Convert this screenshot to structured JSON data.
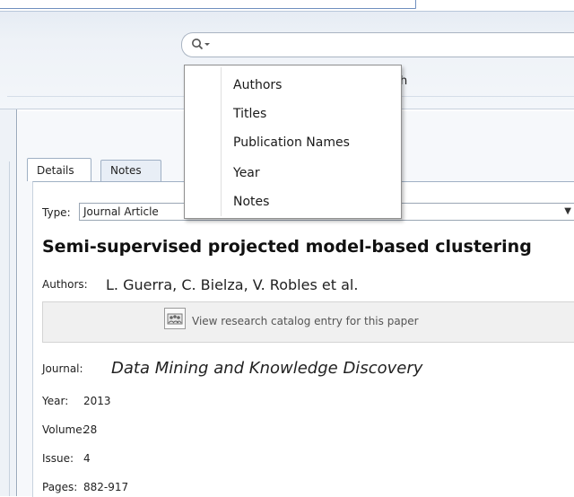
{
  "toolbar": {
    "search_placeholder": "",
    "caption_fragment": "h"
  },
  "search_menu": {
    "items": [
      "Authors",
      "Titles",
      "Publication Names",
      "Year",
      "Notes"
    ]
  },
  "tabs": [
    {
      "label": "Details",
      "active": true
    },
    {
      "label": "Notes",
      "active": false
    }
  ],
  "details": {
    "type_label": "Type:",
    "type_value": "Journal Article",
    "title": "Semi-supervised projected model-based clustering",
    "authors_label": "Authors:",
    "authors_value": "L. Guerra, C. Bielza, V. Robles et al.",
    "catalog_link": "View research catalog entry for this paper",
    "journal_label": "Journal:",
    "journal_value": "Data Mining and Knowledge Discovery",
    "year_label": "Year:",
    "year_value": "2013",
    "volume_label": "Volume:",
    "volume_value": "28",
    "issue_label": "Issue:",
    "issue_value": "4",
    "pages_label": "Pages:",
    "pages_value": "882-917"
  },
  "colors": {
    "accent_border": "#6f8fbf",
    "toolbar_bg": "#eef2f7"
  }
}
